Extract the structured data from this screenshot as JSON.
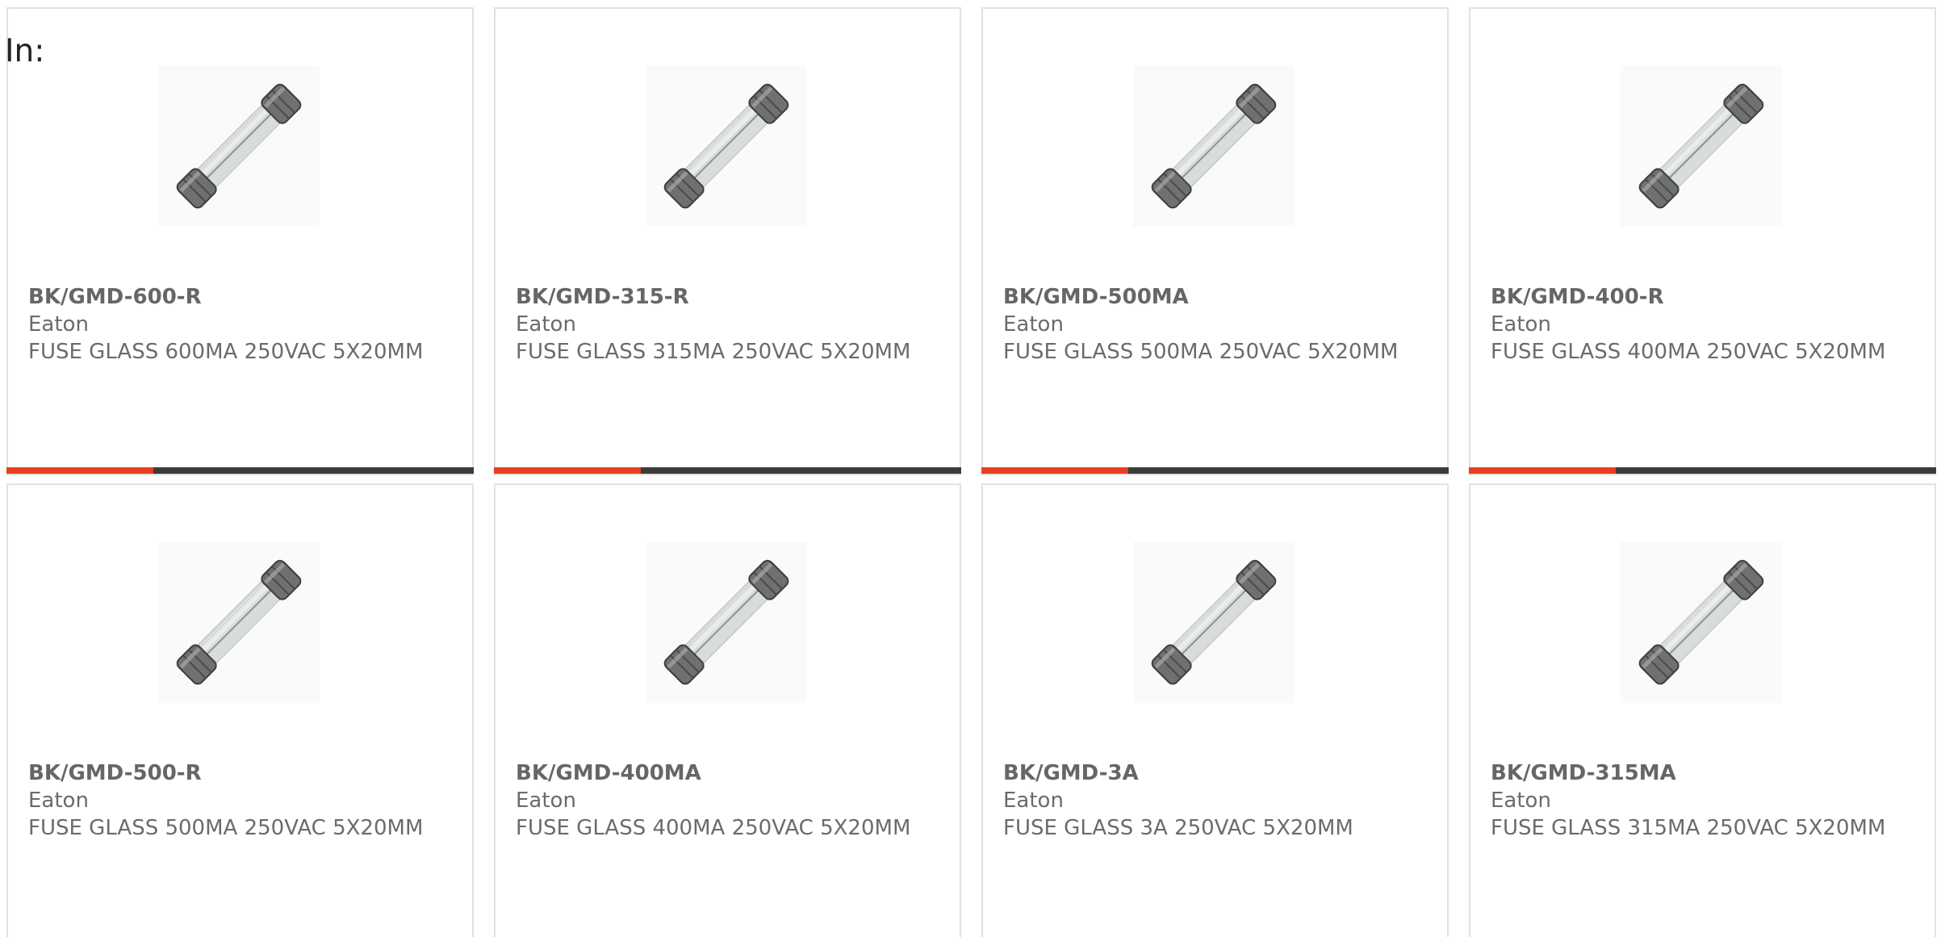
{
  "header": {
    "label": "In:"
  },
  "colors": {
    "accent": "#e8401c",
    "bar": "#3b3b3b",
    "text": "#6b6b6b"
  },
  "products": [
    {
      "part": "BK/GMD-600-R",
      "maker": "Eaton",
      "description": "FUSE GLASS 600MA 250VAC 5X20MM",
      "icon": "glass-fuse-image"
    },
    {
      "part": "BK/GMD-315-R",
      "maker": "Eaton",
      "description": "FUSE GLASS 315MA 250VAC 5X20MM",
      "icon": "glass-fuse-image"
    },
    {
      "part": "BK/GMD-500MA",
      "maker": "Eaton",
      "description": "FUSE GLASS 500MA 250VAC 5X20MM",
      "icon": "glass-fuse-image"
    },
    {
      "part": "BK/GMD-400-R",
      "maker": "Eaton",
      "description": "FUSE GLASS 400MA 250VAC 5X20MM",
      "icon": "glass-fuse-image"
    },
    {
      "part": "BK/GMD-500-R",
      "maker": "Eaton",
      "description": "FUSE GLASS 500MA 250VAC 5X20MM",
      "icon": "glass-fuse-image"
    },
    {
      "part": "BK/GMD-400MA",
      "maker": "Eaton",
      "description": "FUSE GLASS 400MA 250VAC 5X20MM",
      "icon": "glass-fuse-image"
    },
    {
      "part": "BK/GMD-3A",
      "maker": "Eaton",
      "description": "FUSE GLASS 3A 250VAC 5X20MM",
      "icon": "glass-fuse-image"
    },
    {
      "part": "BK/GMD-315MA",
      "maker": "Eaton",
      "description": "FUSE GLASS 315MA 250VAC 5X20MM",
      "icon": "glass-fuse-image"
    }
  ]
}
